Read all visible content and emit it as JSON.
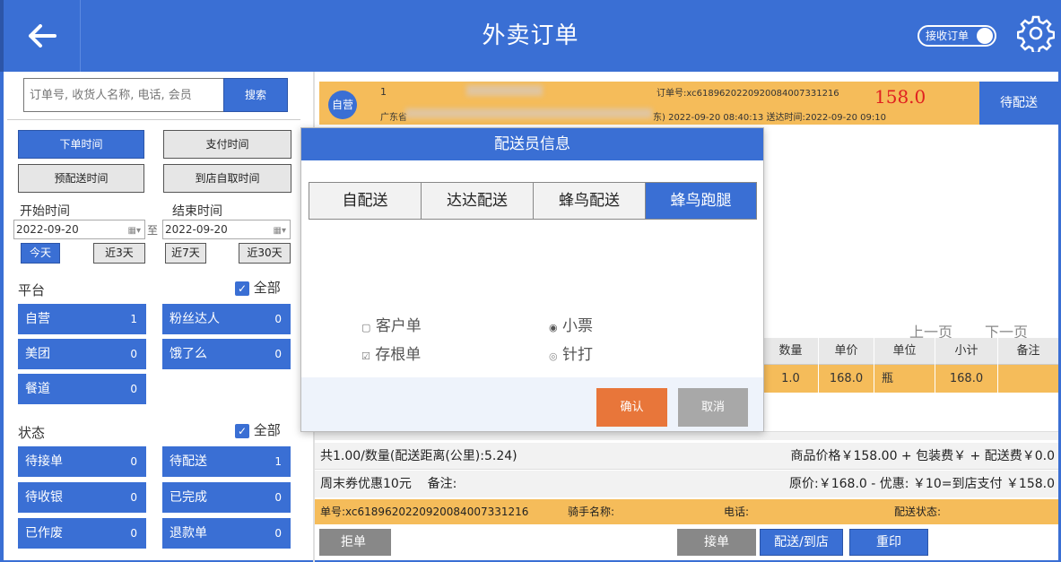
{
  "header": {
    "title": "外卖订单",
    "toggle_label": "接收订单"
  },
  "search": {
    "placeholder": "订单号, 收货人名称, 电话, 会员",
    "button": "搜索"
  },
  "time_filters": {
    "order_time": "下单时间",
    "pay_time": "支付时间",
    "pre_delivery_time": "预配送时间",
    "pickup_time": "到店自取时间"
  },
  "dates": {
    "start_label": "开始时间",
    "end_label": "结束时间",
    "start": "2022-09-20",
    "end": "2022-09-20",
    "to": "至"
  },
  "quick": {
    "today": "今天",
    "d3": "近3天",
    "d7": "近7天",
    "d30": "近30天"
  },
  "platform": {
    "label": "平台",
    "all": "全部",
    "items": [
      {
        "name": "自营",
        "count": "1"
      },
      {
        "name": "粉丝达人",
        "count": "0"
      },
      {
        "name": "美团",
        "count": "0"
      },
      {
        "name": "饿了么",
        "count": "0"
      },
      {
        "name": "餐道",
        "count": "0"
      }
    ]
  },
  "status": {
    "label": "状态",
    "all": "全部",
    "items": [
      {
        "name": "待接单",
        "count": "0"
      },
      {
        "name": "待配送",
        "count": "1"
      },
      {
        "name": "待收银",
        "count": "0"
      },
      {
        "name": "已完成",
        "count": "0"
      },
      {
        "name": "已作废",
        "count": "0"
      },
      {
        "name": "退款单",
        "count": "0"
      }
    ]
  },
  "order": {
    "badge": "自营",
    "index": "1",
    "number_text": "订单号:xc618962022092008400733​1216",
    "amount": "158.0",
    "address_prefix": "广东省",
    "times": "东) 2022-09-20 08:40:13  送达时间:2022-09-20 09:10",
    "status_button": "待配送"
  },
  "pager": {
    "prev": "上一页",
    "next": "下一页"
  },
  "table": {
    "headers": [
      "数量",
      "单价",
      "单位",
      "小计",
      "备注"
    ],
    "row": [
      "1.0",
      "168.0",
      "瓶",
      "168.0",
      ""
    ]
  },
  "summary": {
    "line1_left": "共1.00/数量(配送距离(公里):5.24)",
    "line1_right": "商品价格￥158.00 + 包装费￥ + 配送费￥0.0",
    "line2_left": "周末券优惠10元    备注:",
    "line2_right": "原价:￥168.0 - 优惠: ￥10=到店支付 ￥158.0",
    "line3_order": "单号:xc618962022092008400733​1216",
    "line3_rider": "骑手名称:",
    "line3_phone": "电话:",
    "line3_status": "配送状态:"
  },
  "actions": {
    "reject": "拒单",
    "accept": "接单",
    "deliver": "配送/到店",
    "reprint": "重印"
  },
  "modal": {
    "title": "配送员信息",
    "tabs": [
      "自配送",
      "达达配送",
      "蜂鸟配送",
      "蜂鸟跑腿"
    ],
    "opt_customer": "客户单",
    "opt_stub": "存根单",
    "opt_ticket": "小票",
    "opt_needle": "针打",
    "confirm": "确认",
    "cancel": "取消"
  },
  "colors": {
    "primary": "#3a6fd4",
    "order_bg": "#f5bc5a",
    "amount": "#e02020",
    "confirm": "#e8763a"
  }
}
